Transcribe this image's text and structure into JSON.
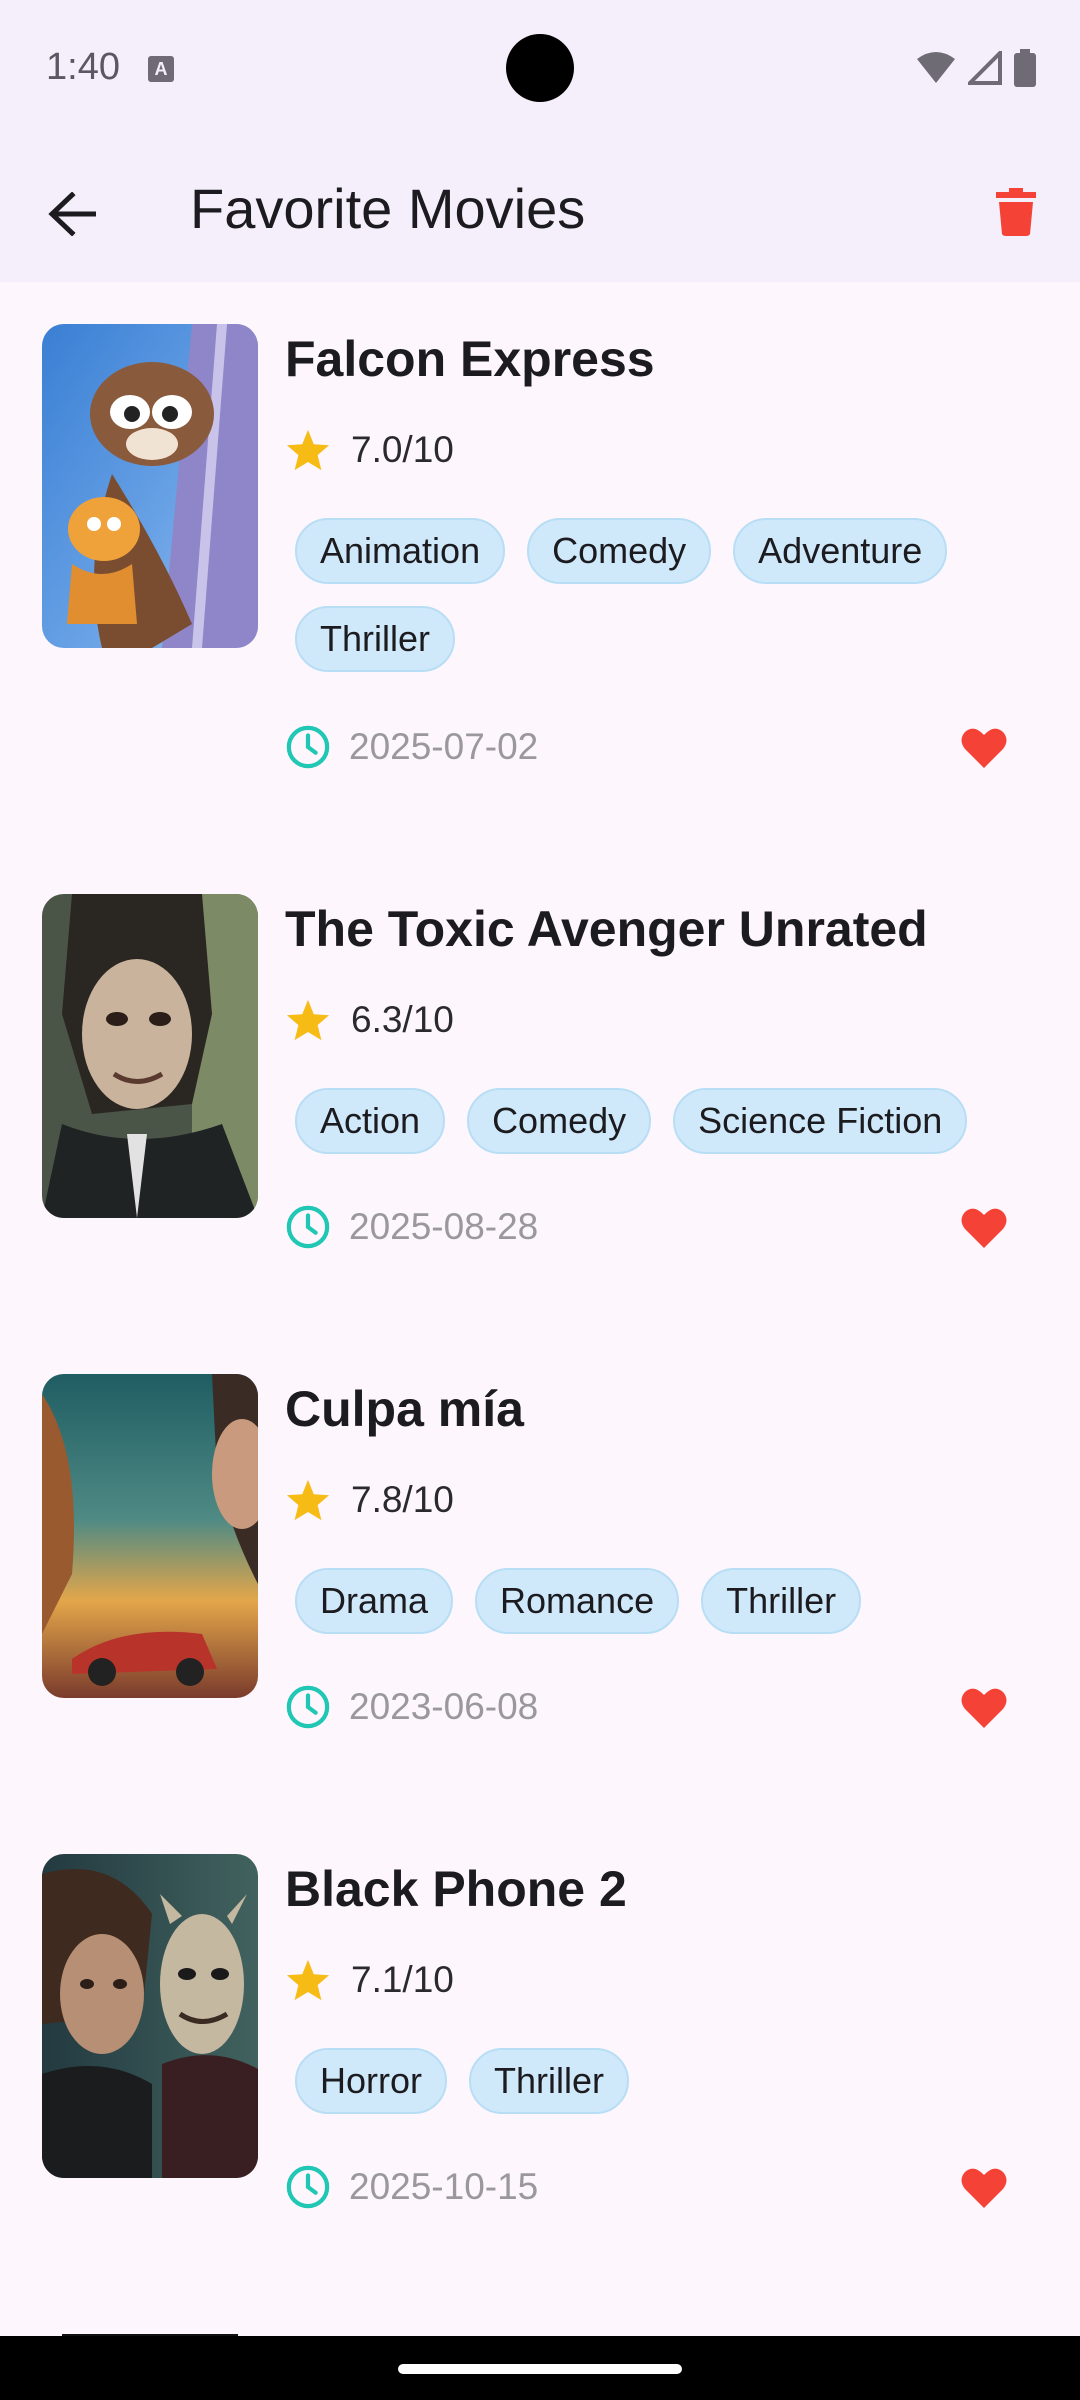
{
  "status_bar": {
    "time": "1:40",
    "notification_icon": "a-icon"
  },
  "app_bar": {
    "title": "Favorite Movies",
    "back_icon": "arrow-left-icon",
    "delete_icon": "trash-icon",
    "delete_color": "#f44336"
  },
  "colors": {
    "star": "#f7bb15",
    "clock": "#1fc7b4",
    "heart": "#f44336",
    "chip_bg": "#cfe9fa"
  },
  "movies": [
    {
      "title": "Falcon Express",
      "rating": "7.0/10",
      "genres": [
        "Animation",
        "Comedy",
        "Adventure",
        "Thriller"
      ],
      "date": "2025-07-02"
    },
    {
      "title": "The Toxic Avenger Unrated",
      "rating": "6.3/10",
      "genres": [
        "Action",
        "Comedy",
        "Science Fiction"
      ],
      "date": "2025-08-28"
    },
    {
      "title": "Culpa mía",
      "rating": "7.8/10",
      "genres": [
        "Drama",
        "Romance",
        "Thriller"
      ],
      "date": "2023-06-08"
    },
    {
      "title": "Black Phone 2",
      "rating": "7.1/10",
      "genres": [
        "Horror",
        "Thriller"
      ],
      "date": "2025-10-15"
    }
  ]
}
